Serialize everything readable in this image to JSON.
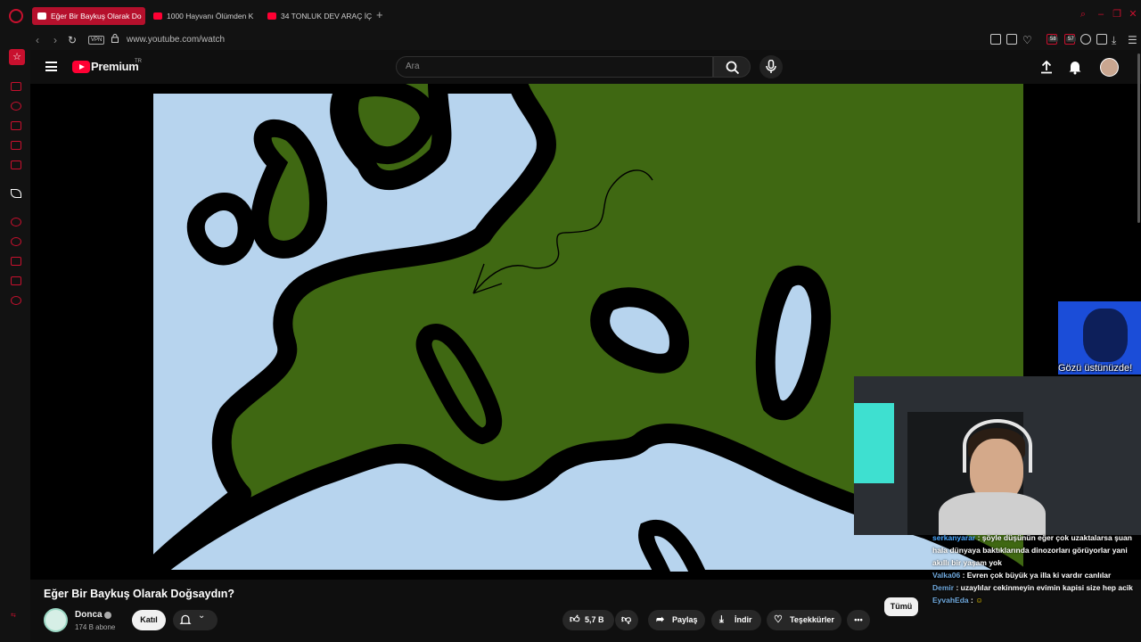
{
  "browser": {
    "tabs": [
      {
        "label": "Eğer Bir Baykuş Olarak Do",
        "active": true
      },
      {
        "label": "1000 Hayvanı Ölümden K",
        "active": false
      },
      {
        "label": "34 TONLUK DEV ARAÇ İÇ",
        "active": false
      }
    ],
    "vpn_label": "VPN",
    "url": "www.youtube.com/watch",
    "badges": [
      "58",
      "57"
    ]
  },
  "youtube": {
    "brand": "Premium",
    "region": "TR",
    "search_placeholder": "Ara"
  },
  "overlay": {
    "caption": "Gözü üstünüzde!"
  },
  "chat": [
    {
      "user": "serkanyarar",
      "message": "şöyle düşünün eğer çok uzaktalarsa şuan hala dünyaya baktıklarında dinozorları görüyorlar yani akıllı bir yaşam yok"
    },
    {
      "user": "Valka06",
      "message": "Evren çok büyük ya illa ki vardır canlılar"
    },
    {
      "user": "Demir",
      "message": "uzaylılar cekinmeyin evimin kapisi size hep acik"
    },
    {
      "user": "EyvahEda",
      "message": ""
    }
  ],
  "video": {
    "title": "Eğer Bir Baykuş Olarak Doğsaydın?",
    "channel": "Donca",
    "subscribers": "174 B abone",
    "join_label": "Katıl",
    "likes": "5,7 B",
    "share_label": "Paylaş",
    "download_label": "İndir",
    "thanks_label": "Teşekkürler"
  },
  "chat_filter": {
    "all_label": "Tümü"
  },
  "colors": {
    "accent": "#c8102e",
    "youtube_red": "#ff0033",
    "land": "#3f6812",
    "water": "#b7d4ee"
  }
}
